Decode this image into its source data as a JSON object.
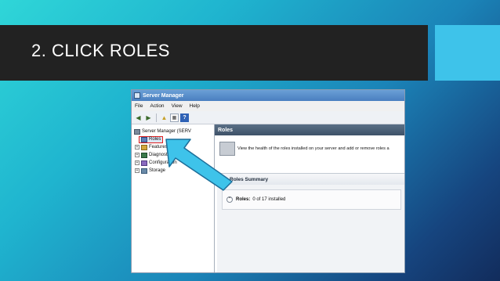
{
  "slide": {
    "title": "2. CLICK ROLES"
  },
  "window": {
    "title": "Server Manager",
    "menu": [
      "File",
      "Action",
      "View",
      "Help"
    ],
    "toolbar": {
      "back_icon": "back-arrow-icon",
      "forward_icon": "forward-arrow-icon",
      "help_label": "?"
    },
    "tree": {
      "root": "Server Manager (SERV",
      "items": [
        {
          "label": "Roles",
          "icon": "roles-icon",
          "selected": true
        },
        {
          "label": "Features",
          "icon": "features-icon"
        },
        {
          "label": "Diagnostics",
          "icon": "diagnostics-icon"
        },
        {
          "label": "Configuration",
          "icon": "configuration-icon"
        },
        {
          "label": "Storage",
          "icon": "storage-icon"
        }
      ]
    },
    "main": {
      "header": "Roles",
      "intro": "View the health of the roles installed on your server and add or remove roles a",
      "summary_title": "Roles Summary",
      "roles_label": "Roles:",
      "roles_value": "0 of 17 installed"
    }
  },
  "colors": {
    "title_bar": "#222222",
    "accent": "#3ec3ea",
    "arrow": "#3ec3ea",
    "highlight": "#e01f1f"
  }
}
